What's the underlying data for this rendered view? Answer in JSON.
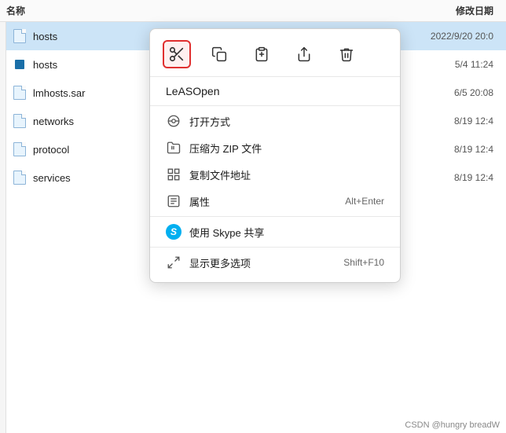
{
  "headers": {
    "name": "名称",
    "date": "修改日期"
  },
  "files": [
    {
      "name": "hosts",
      "date": "2022/9/20 20:0",
      "type": "selected",
      "iconType": "generic"
    },
    {
      "name": "hosts",
      "date": "5/4 11:24",
      "type": "normal",
      "iconType": "blue"
    },
    {
      "name": "lmhosts.sar",
      "date": "6/5 20:08",
      "type": "normal",
      "iconType": "generic"
    },
    {
      "name": "networks",
      "date": "8/19 12:4",
      "type": "normal",
      "iconType": "generic"
    },
    {
      "name": "protocol",
      "date": "8/19 12:4",
      "type": "normal",
      "iconType": "generic"
    },
    {
      "name": "services",
      "date": "8/19 12:4",
      "type": "normal",
      "iconType": "generic"
    }
  ],
  "contextMenu": {
    "leASOpen": "LeASOpen",
    "toolbar": {
      "cut": "✂",
      "copy": "⧉",
      "paste": "⬛",
      "share": "↗",
      "delete": "🗑"
    },
    "items": [
      {
        "label": "打开方式",
        "shortcut": "",
        "icon": "open-with"
      },
      {
        "label": "压缩为 ZIP 文件",
        "shortcut": "",
        "icon": "zip"
      },
      {
        "label": "复制文件地址",
        "shortcut": "",
        "icon": "copy-path"
      },
      {
        "label": "属性",
        "shortcut": "Alt+Enter",
        "icon": "props"
      },
      {
        "label": "使用 Skype 共享",
        "shortcut": "",
        "icon": "skype"
      },
      {
        "label": "显示更多选项",
        "shortcut": "Shift+F10",
        "icon": "more"
      }
    ]
  },
  "watermark": "CSDN @hungry breadW"
}
